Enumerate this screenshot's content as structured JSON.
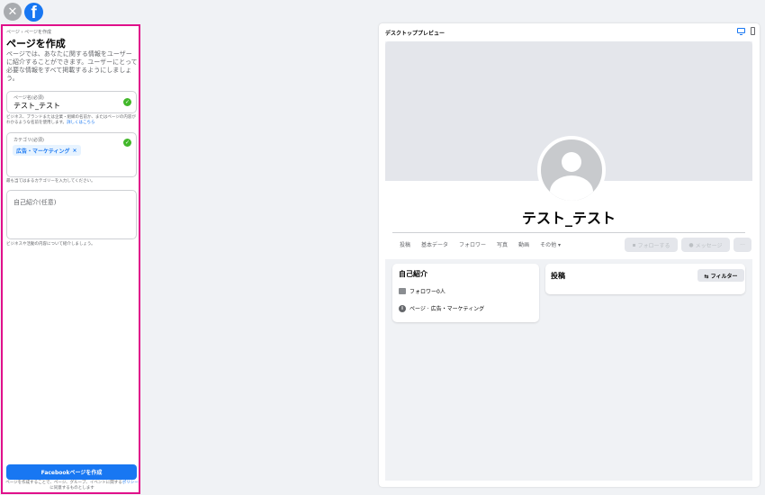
{
  "topbar": {
    "close_symbol": "✕",
    "logo_letter": "f"
  },
  "form": {
    "breadcrumb": "ページ › ページを作成",
    "title": "ページを作成",
    "description": "ページでは、あなたに関する情報をユーザーに紹介することができます。ユーザーにとって必要な情報をすべて掲載するようにしましょう。",
    "name_field": {
      "label": "ページ名(必須)",
      "value": "テスト_テスト"
    },
    "name_help": "ビジネス、ブランドまたは企業・組織の名前か、またはページの内容がわかるような名前を使用します。",
    "name_help_link": "詳しくはこちら",
    "category_field": {
      "label": "カテゴリ(必須)",
      "chip": "広告・マーケティング",
      "chip_remove": "×"
    },
    "category_help": "最も当てはまるカテゴリーを入力してください。",
    "bio_field": {
      "placeholder": "自己紹介(任意)"
    },
    "bio_help": "ビジネスや活動の内容について紹介しましょう。",
    "create_button": "Facebookページを作成",
    "terms_text": "ページを作成することで、ページ、グループ、イベントに関する",
    "terms_link": "ポリシー",
    "terms_end": "に同意するものとします"
  },
  "preview": {
    "title": "デスクトッププレビュー",
    "page_name": "テスト_テスト",
    "tabs": [
      "投稿",
      "基本データ",
      "フォロワー",
      "写真",
      "動画",
      "その他 ▾"
    ],
    "follow_button": "フォローする",
    "message_button": "メッセージ",
    "more_button": "···",
    "intro": {
      "title": "自己紹介",
      "followers": "フォロワー0人",
      "category": "ページ · 広告・マーケティング"
    },
    "posts": {
      "title": "投稿",
      "filter_button": "⇆ フィルター"
    }
  }
}
